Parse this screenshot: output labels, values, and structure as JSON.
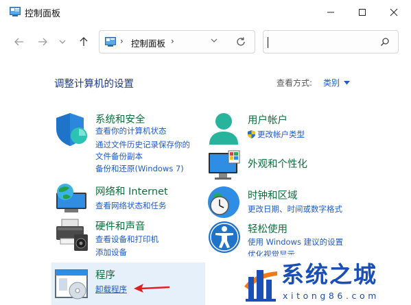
{
  "window": {
    "title": "控制面板",
    "controls": {
      "minimize_icon": "minimize-icon",
      "maximize_icon": "maximize-icon",
      "close_icon": "close-icon"
    }
  },
  "nav": {
    "back_icon": "back-arrow-icon",
    "forward_icon": "forward-arrow-icon",
    "recent_icon": "chevron-down-icon",
    "up_icon": "up-arrow-icon"
  },
  "address": {
    "crumbs": [
      "控制面板"
    ],
    "separator": "›"
  },
  "search": {
    "placeholder": ""
  },
  "heading": {
    "title": "调整计算机的设置",
    "view_by_label": "查看方式:",
    "view_by_value": "类别"
  },
  "categories": [
    {
      "title": "系统和安全",
      "icon": "shield-icon",
      "links": [
        "查看你的计算机状态",
        "通过文件历史记录保存你的",
        "文件备份副本",
        "备份和还原(Windows 7)"
      ]
    },
    {
      "title": "网络和 Internet",
      "icon": "network-icon",
      "links": [
        "查看网络状态和任务"
      ]
    },
    {
      "title": "硬件和声音",
      "icon": "printer-icon",
      "links": [
        "查看设备和打印机",
        "添加设备"
      ]
    },
    {
      "title": "程序",
      "icon": "programs-icon",
      "links": [
        "卸载程序"
      ]
    },
    {
      "title": "用户帐户",
      "icon": "user-icon",
      "links": [
        "更改帐户类型"
      ]
    },
    {
      "title": "外观和个性化",
      "icon": "monitor-icon",
      "links": []
    },
    {
      "title": "时钟和区域",
      "icon": "clock-icon",
      "links": [
        "更改日期、时间或数字格式"
      ]
    },
    {
      "title": "轻松使用",
      "icon": "accessibility-icon",
      "links": [
        "使用 Windows 建议的设置",
        "优化视觉显示"
      ]
    }
  ],
  "watermark": {
    "text": "系统之城",
    "url": "xitong86.com"
  },
  "colors": {
    "category_title": "#0c6e3a",
    "link": "#1e5bc6",
    "heading": "#1f3a8a",
    "watermark": "#1a4fb5",
    "arrow": "#e02020"
  }
}
